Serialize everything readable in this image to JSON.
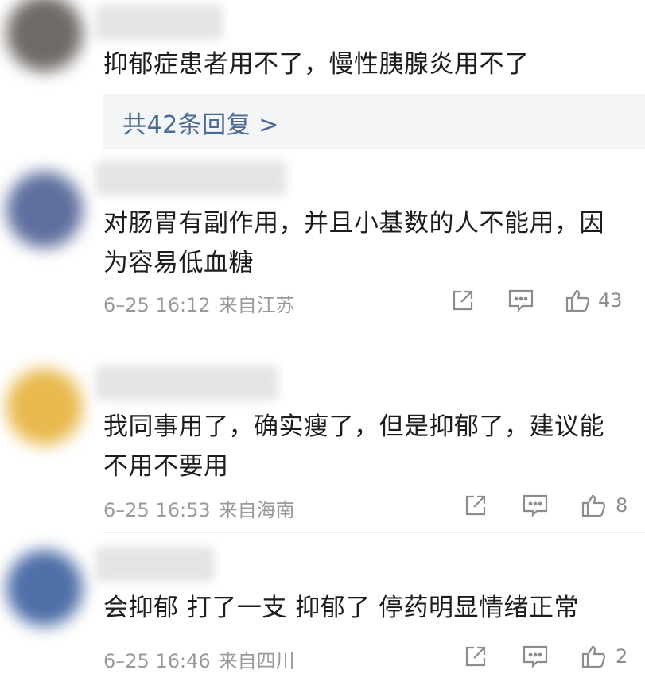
{
  "comments": [
    {
      "avatar_color": "#6f6a66",
      "text": "抑郁症患者用不了，慢性胰腺炎用不了",
      "replies_label": "共42条回复 >"
    },
    {
      "avatar_color": "#5f6f9e",
      "text": "对肠胃有副作用，并且小基数的人不能用，因为容易低血糖",
      "date": "6–25 16:12",
      "location": "来自江苏",
      "likes": "43"
    },
    {
      "avatar_color": "#e9b94e",
      "text": "我同事用了，确实瘦了，但是抑郁了，建议能不用不要用",
      "date": "6–25 16:53",
      "location": "来自海南",
      "likes": "8"
    },
    {
      "avatar_color": "#4f6fa8",
      "text": "会抑郁 打了一支 抑郁了 停药明显情绪正常",
      "date": "6–25 16:46",
      "location": "来自四川",
      "likes": "2"
    }
  ],
  "icons": {
    "share": "share-icon",
    "comment": "comment-icon",
    "like": "thumbs-up-icon"
  }
}
